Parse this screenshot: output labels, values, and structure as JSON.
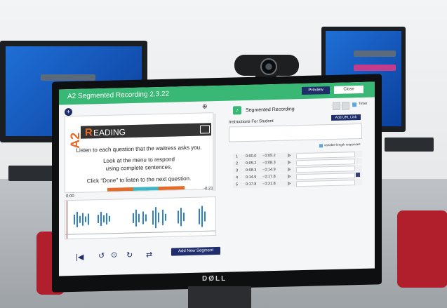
{
  "app": {
    "title": "A2 Segmented Recording 2.3.22",
    "preview_label": "Preview",
    "close_label": "Close"
  },
  "lesson": {
    "level": "A2",
    "heading_initial": "R",
    "heading_rest": "EADING",
    "line1": "Listen to each question that the waitress asks you.",
    "line2": "Look at the menu to respond",
    "line3": "using complete sentences.",
    "line4": "Click \"Done\" to listen to the next question."
  },
  "player": {
    "time_start": "0:00",
    "time_end": "-0:21",
    "add_segment_label": "Add New Segment"
  },
  "panel": {
    "segmented_label": "Segmented Recording",
    "timer_label": "Timer",
    "add_url_label": "Add URL Link",
    "instructions_label": "Instructions For Student",
    "variable_label": "variable-length responses"
  },
  "segments": [
    {
      "n": "1",
      "start": "0:00.0",
      "end": "- 0:05.2"
    },
    {
      "n": "2",
      "start": "0:05.2",
      "end": "- 0:08.3"
    },
    {
      "n": "3",
      "start": "0:08.3",
      "end": "- 0:14.9"
    },
    {
      "n": "4",
      "start": "0:14.9",
      "end": "- 0:17.8"
    },
    {
      "n": "5",
      "start": "0:17.8",
      "end": "- 0:21.8"
    }
  ],
  "hardware": {
    "brand": "DØLL"
  },
  "colors": {
    "accent_green": "#39b774",
    "navy": "#1f2e6b",
    "orange": "#e46b2a"
  }
}
